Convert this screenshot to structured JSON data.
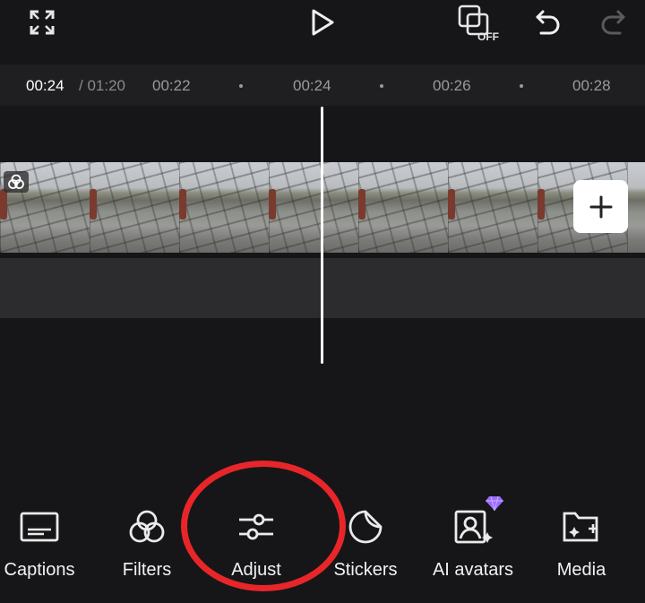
{
  "topbar": {
    "fullscreen_icon": "fullscreen-icon",
    "play_icon": "play-icon",
    "keyframe_toggle": {
      "icon": "keyframe-off-icon",
      "badge": "OFF"
    },
    "undo_icon": "undo-icon",
    "redo_icon": "redo-icon"
  },
  "ruler": {
    "current_time": "00:24",
    "total_time": "/ 01:20",
    "ticks": [
      "00:22",
      "00:24",
      "00:26",
      "00:28"
    ]
  },
  "timeline": {
    "clip_badge_icon": "overlay-icon",
    "add_clip_label": "+"
  },
  "toolbar": {
    "items": [
      {
        "label": "Captions",
        "icon": "captions-icon"
      },
      {
        "label": "Filters",
        "icon": "filters-icon"
      },
      {
        "label": "Adjust",
        "icon": "adjust-icon"
      },
      {
        "label": "Stickers",
        "icon": "stickers-icon"
      },
      {
        "label": "AI avatars",
        "icon": "ai-avatars-icon",
        "premium": true
      },
      {
        "label": "Media",
        "icon": "media-icon"
      }
    ]
  },
  "colors": {
    "background": "#161618",
    "ruler": "#1f1f21",
    "audio_track": "#2c2c2e",
    "annotation": "#e8262a",
    "premium": "#9b6bff"
  }
}
